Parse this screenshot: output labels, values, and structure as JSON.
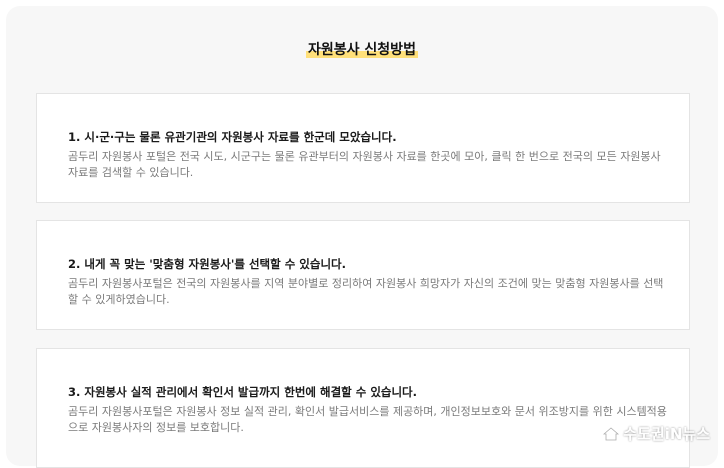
{
  "page": {
    "title": "자원봉사 신청방법"
  },
  "cards": [
    {
      "title": "1. 시·군·구는 물론 유관기관의 자원봉사 자료를 한군데 모았습니다.",
      "body": "곰두리 자원봉사 포털은 전국 시도, 시군구는 물론 유관부터의 자원봉사 자료를 한곳에 모아, 클릭 한 번으로 전국의 모든 자원봉사 자료를 검색할 수 있습니다."
    },
    {
      "title": "2. 내게 꼭 맞는 '맞춤형 자원봉사'를 선택할 수 있습니다.",
      "body": "곰두리 자원봉사포털은 전국의 자원봉사를 지역 분야별로 정리하여 자원봉사 희망자가 자신의 조건에 맞는 맞춤형 자원봉사를 선택할 수 있게하였습니다."
    },
    {
      "title": "3. 자원봉사 실적 관리에서 확인서 발급까지 한번에 해결할 수 있습니다.",
      "body": "곰두리 자원봉사포털은 자원봉사 정보 실적 관리, 확인서 발급서비스를 제공하며, 개인정보보호와 문서 위조방지를 위한 시스템적용으로 자원봉사자의 정보를 보호합니다."
    }
  ],
  "watermark": {
    "text": "수도권iN뉴스",
    "icon": "house-logo-icon"
  },
  "colors": {
    "background": "#f7f7f7",
    "card": "#ffffff",
    "title_highlight": "#ffe07a",
    "body_text": "#7a7a7a"
  }
}
